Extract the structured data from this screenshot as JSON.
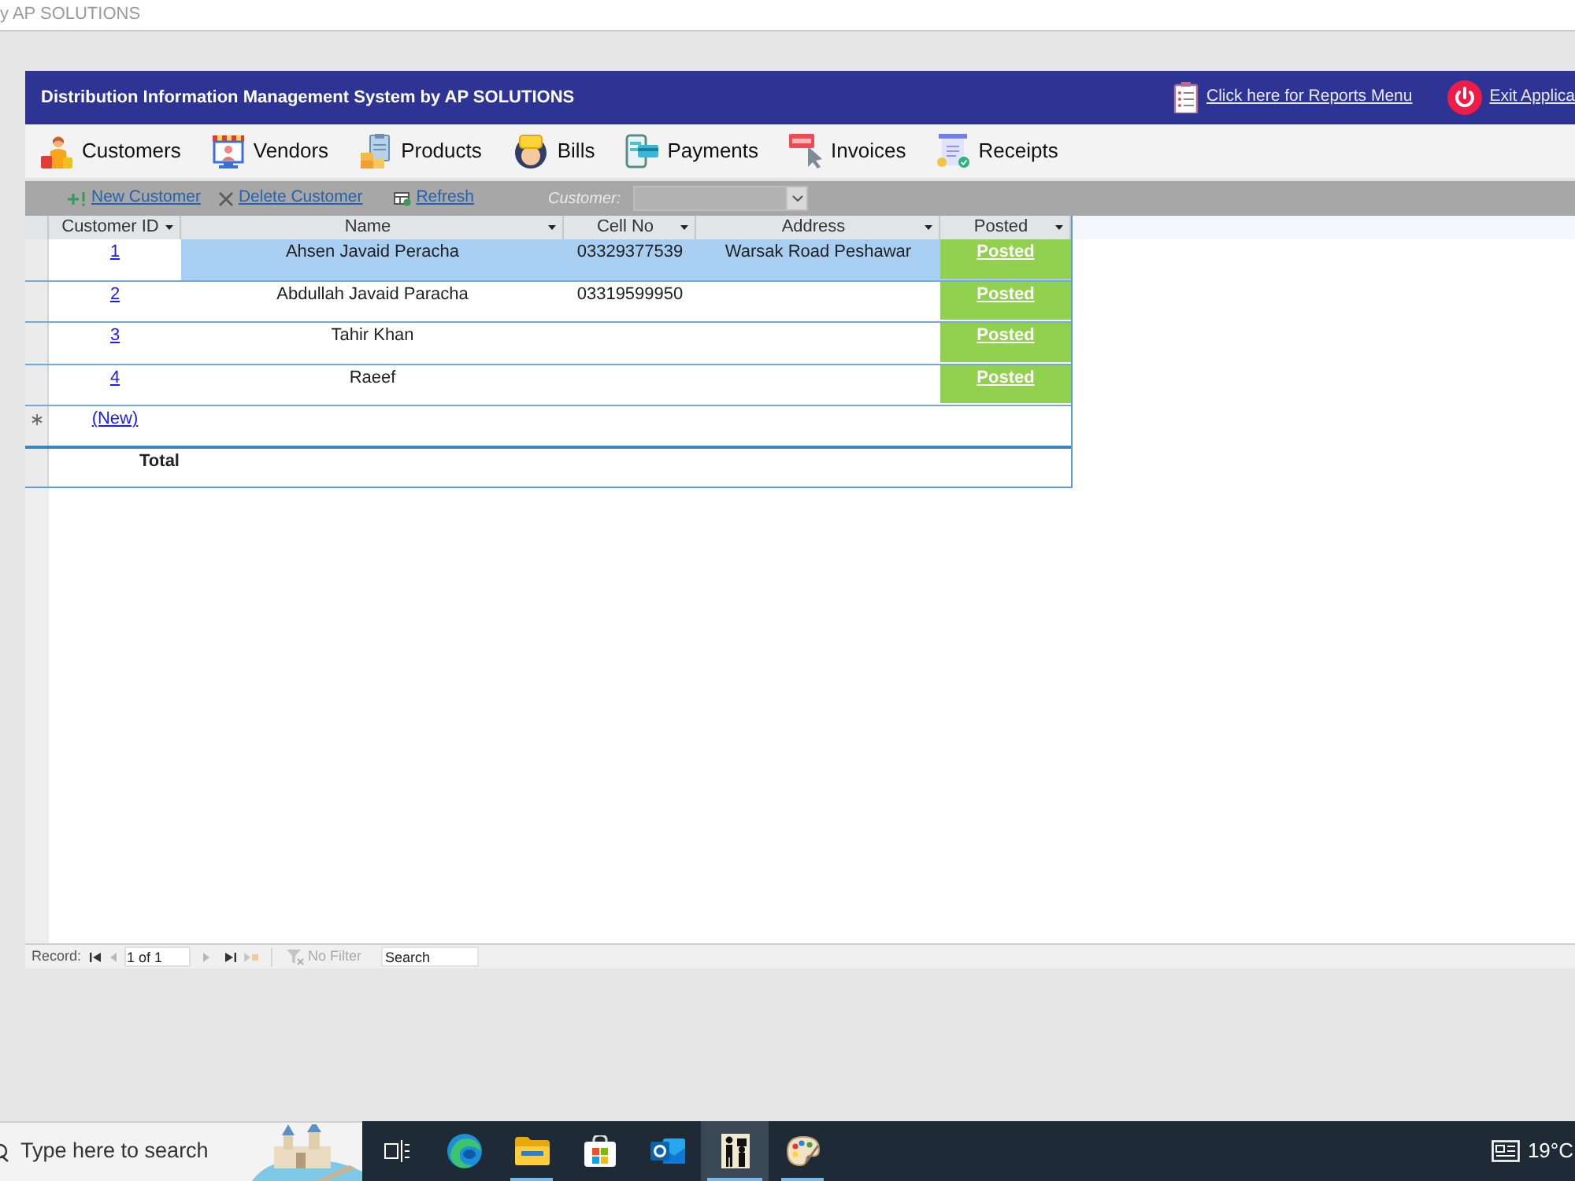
{
  "window": {
    "title": "y AP SOLUTIONS"
  },
  "header": {
    "title": "Distribution Information Management System by AP SOLUTIONS",
    "links": [
      {
        "kind": "reports",
        "label": "Click here for Reports Menu"
      },
      {
        "kind": "exit",
        "label": "Exit Applica"
      }
    ]
  },
  "nav": [
    {
      "kind": "customers",
      "label": "Customers"
    },
    {
      "kind": "vendors",
      "label": "Vendors"
    },
    {
      "kind": "products",
      "label": "Products"
    },
    {
      "kind": "bills",
      "label": "Bills"
    },
    {
      "kind": "payments",
      "label": "Payments"
    },
    {
      "kind": "invoices",
      "label": "Invoices"
    },
    {
      "kind": "receipts",
      "label": "Receipts"
    }
  ],
  "toolbar": {
    "actions": [
      {
        "kind": "new",
        "label": "New Customer"
      },
      {
        "kind": "delete",
        "label": "Delete Customer"
      },
      {
        "kind": "refresh",
        "label": "Refresh"
      }
    ],
    "filter": {
      "label": "Customer:"
    }
  },
  "table": {
    "columns": [
      "Customer ID",
      "Name",
      "Cell No",
      "Address",
      "Posted"
    ],
    "rows": [
      {
        "selected": true,
        "id": "1",
        "name": "Ahsen Javaid Peracha",
        "cell_no": "03329377539",
        "address": "Warsak Road Peshawar",
        "posted": "Posted"
      },
      {
        "selected": false,
        "id": "2",
        "name": "Abdullah Javaid Paracha",
        "cell_no": "03319599950",
        "posted": "Posted"
      },
      {
        "selected": false,
        "id": "3",
        "name": "Tahir Khan",
        "posted": "Posted"
      },
      {
        "selected": false,
        "id": "4",
        "name": "Raeef",
        "posted": "Posted"
      }
    ],
    "new_row": "(New)",
    "total_row": "Total"
  },
  "record_nav": {
    "label": "Record:",
    "position": "1 of 1",
    "filter": "No Filter",
    "search": {
      "placeholder": "Search"
    }
  },
  "taskbar": {
    "search": {
      "placeholder": "Type here to search"
    },
    "apps": [
      {
        "kind": "task-view",
        "running": false,
        "selected": false
      },
      {
        "kind": "browser",
        "running": false,
        "selected": false
      },
      {
        "kind": "folder",
        "running": true,
        "selected": false
      },
      {
        "kind": "store",
        "running": false,
        "selected": false
      },
      {
        "kind": "mail",
        "running": false,
        "selected": false
      },
      {
        "kind": "figures",
        "running": true,
        "selected": true
      },
      {
        "kind": "palette",
        "running": true,
        "selected": false
      }
    ],
    "weather": "19°C"
  }
}
